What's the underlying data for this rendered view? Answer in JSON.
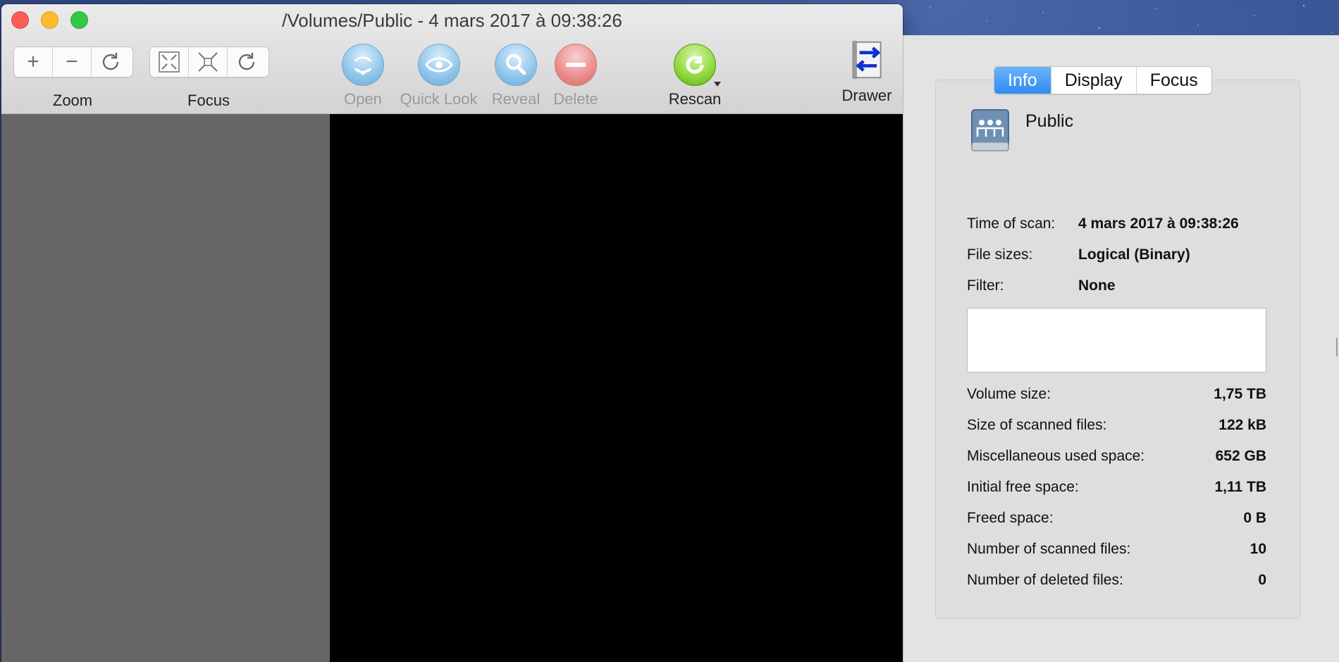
{
  "window": {
    "title": "/Volumes/Public - 4 mars 2017 à 09:38:26"
  },
  "toolbar": {
    "zoom": {
      "label": "Zoom",
      "buttons": [
        "+",
        "−",
        "reset"
      ]
    },
    "focus": {
      "label": "Focus"
    },
    "open_label": "Open",
    "quicklook_label": "Quick Look",
    "reveal_label": "Reveal",
    "delete_label": "Delete",
    "rescan_label": "Rescan",
    "drawer_label": "Drawer"
  },
  "drawer": {
    "tabs": [
      "Info",
      "Display",
      "Focus"
    ],
    "active_tab": "Info",
    "volume_name": "Public",
    "meta": [
      {
        "key": "Time of scan:",
        "value": "4 mars 2017 à 09:38:26"
      },
      {
        "key": "File sizes:",
        "value": "Logical (Binary)"
      },
      {
        "key": "Filter:",
        "value": "None"
      }
    ],
    "stats": [
      {
        "key": "Volume size:",
        "value": "1,75 TB"
      },
      {
        "key": "Size of scanned files:",
        "value": "122 kB"
      },
      {
        "key": "Miscellaneous used space:",
        "value": "652 GB"
      },
      {
        "key": "Initial free space:",
        "value": "1,11 TB"
      },
      {
        "key": "Freed space:",
        "value": "0 B"
      },
      {
        "key": "Number of scanned files:",
        "value": "10"
      },
      {
        "key": "Number of deleted files:",
        "value": "0"
      }
    ]
  }
}
